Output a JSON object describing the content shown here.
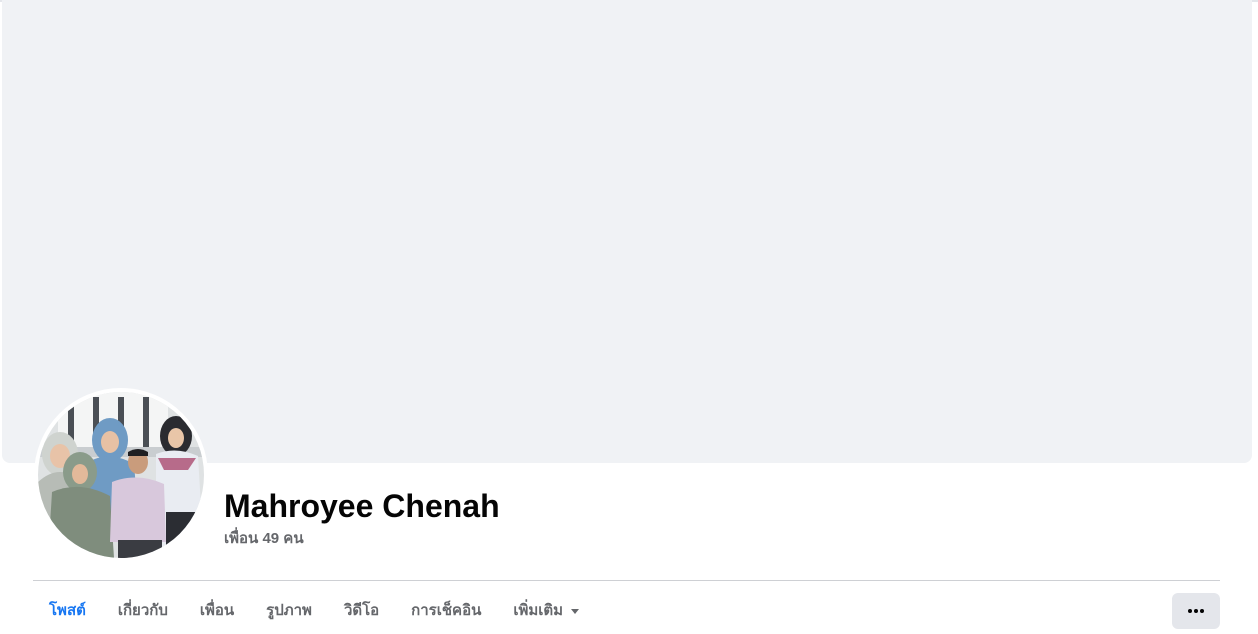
{
  "profile": {
    "name": "Mahroyee Chenah",
    "friends_text": "เพื่อน 49 คน"
  },
  "tabs": [
    {
      "label": "โพสต์",
      "active": true
    },
    {
      "label": "เกี่ยวกับ",
      "active": false
    },
    {
      "label": "เพื่อน",
      "active": false
    },
    {
      "label": "รูปภาพ",
      "active": false
    },
    {
      "label": "วิดีโอ",
      "active": false
    },
    {
      "label": "การเช็คอิน",
      "active": false
    },
    {
      "label": "เพิ่มเติม",
      "active": false
    }
  ],
  "icons": {
    "more_tab": "caret-down-icon",
    "more_options": "ellipsis-icon"
  },
  "colors": {
    "accent": "#1877f2",
    "cover": "#f0f2f5",
    "secondary_text": "#65676b"
  }
}
